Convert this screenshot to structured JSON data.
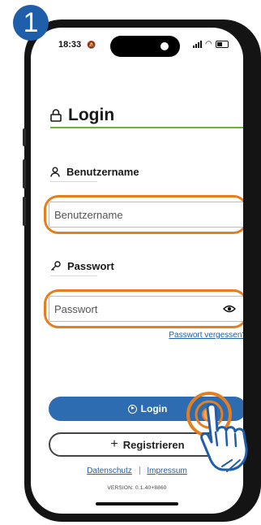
{
  "step_number": "1",
  "status_bar": {
    "time": "18:33"
  },
  "page": {
    "title": "Login"
  },
  "username": {
    "label": "Benutzername",
    "placeholder": "Benutzername"
  },
  "password": {
    "label": "Passwort",
    "placeholder": "Passwort",
    "forgot_link": "Passwort vergessen?"
  },
  "actions": {
    "login_label": "Login",
    "register_label": "Registrieren"
  },
  "footer": {
    "privacy_link": "Datenschutz",
    "imprint_link": "Impressum",
    "version": "VERSION: 0.1.40+8860"
  },
  "icons": [
    "lock-icon",
    "user-icon",
    "key-icon",
    "eye-icon",
    "play-circle-icon",
    "plus-icon",
    "tap-hand-icon"
  ],
  "colors": {
    "accent_blue": "#2d6cb0",
    "badge_blue": "#1f5ea8",
    "highlight_orange": "#e67e1e",
    "title_rule_green": "#6ab43a"
  }
}
